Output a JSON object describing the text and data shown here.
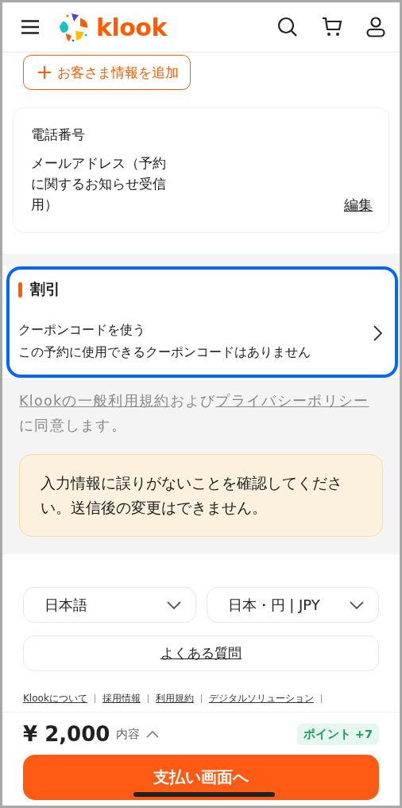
{
  "header": {
    "logo": "klook"
  },
  "add_traveler_button": {
    "label": "お客さま情報を追加"
  },
  "contact_card": {
    "fields": [
      "電話番号",
      "メールアドレス（予約に関するお知らせ受信用）"
    ],
    "edit_link": "編集"
  },
  "discount": {
    "title": "割引",
    "coupon_label": "クーポンコードを使う",
    "coupon_note": "この予約に使用できるクーポンコードはありません",
    "highlighted": true
  },
  "terms": [
    {
      "kind": "link",
      "text": "Klookの一般利用規約"
    },
    {
      "kind": "text",
      "text": "および"
    },
    {
      "kind": "link",
      "text": "プライバシーポリシー"
    },
    {
      "kind": "text",
      "text": "に同意します。"
    }
  ],
  "notice": "入力情報に誤りがないことを確認してください。送信後の変更はできません。",
  "footer": {
    "language": "日本語",
    "currency": "日本・円 | JPY",
    "faq": "よくある質問",
    "links": [
      "Klookについて",
      "採用情報",
      "利用規約",
      "デジタルソリューション"
    ]
  },
  "checkout": {
    "price": "¥ 2,000",
    "details": "内容",
    "points": "ポイント +7",
    "pay_button": "支払い画面へ"
  }
}
